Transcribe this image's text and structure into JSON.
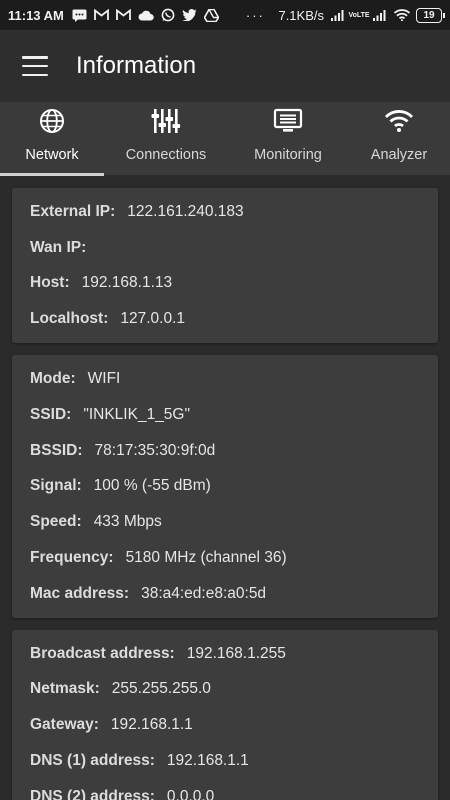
{
  "status_bar": {
    "time": "11:13 AM",
    "dots": "···",
    "speed": "7.1KB/s",
    "battery": "19",
    "left_icons": [
      "message-icon",
      "gmail-icon",
      "gmail-icon",
      "cloud-icon",
      "whatsapp-icon",
      "twitter-icon",
      "drive-icon"
    ],
    "right_icons": [
      "signal-icon",
      "volte-icon",
      "signal-icon",
      "wifi-icon"
    ],
    "volte_label": "VoLTE"
  },
  "appbar": {
    "title": "Information"
  },
  "tabs": [
    {
      "label": "Network",
      "icon": "globe-icon",
      "active": true
    },
    {
      "label": "Connections",
      "icon": "connections-icon",
      "active": false
    },
    {
      "label": "Monitoring",
      "icon": "monitor-icon",
      "active": false
    },
    {
      "label": "Analyzer",
      "icon": "wifi-icon",
      "active": false
    }
  ],
  "cards": [
    {
      "rows": [
        {
          "key": "External IP:",
          "value": "122.161.240.183"
        },
        {
          "key": "Wan IP:",
          "value": ""
        },
        {
          "key": "Host:",
          "value": "192.168.1.13"
        },
        {
          "key": "Localhost:",
          "value": "127.0.0.1"
        }
      ]
    },
    {
      "rows": [
        {
          "key": "Mode:",
          "value": "WIFI"
        },
        {
          "key": "SSID:",
          "value": "\"INKLIK_1_5G\""
        },
        {
          "key": "BSSID:",
          "value": "78:17:35:30:9f:0d"
        },
        {
          "key": "Signal:",
          "value": "100 % (-55 dBm)"
        },
        {
          "key": "Speed:",
          "value": "433 Mbps"
        },
        {
          "key": "Frequency:",
          "value": "5180 MHz (channel 36)"
        },
        {
          "key": "Mac address:",
          "value": "38:a4:ed:e8:a0:5d"
        }
      ]
    },
    {
      "rows": [
        {
          "key": "Broadcast address:",
          "value": "192.168.1.255"
        },
        {
          "key": "Netmask:",
          "value": "255.255.255.0"
        },
        {
          "key": "Gateway:",
          "value": "192.168.1.1"
        },
        {
          "key": "DNS (1) address:",
          "value": "192.168.1.1"
        },
        {
          "key": "DNS (2) address:",
          "value": "0.0.0.0"
        }
      ]
    }
  ]
}
